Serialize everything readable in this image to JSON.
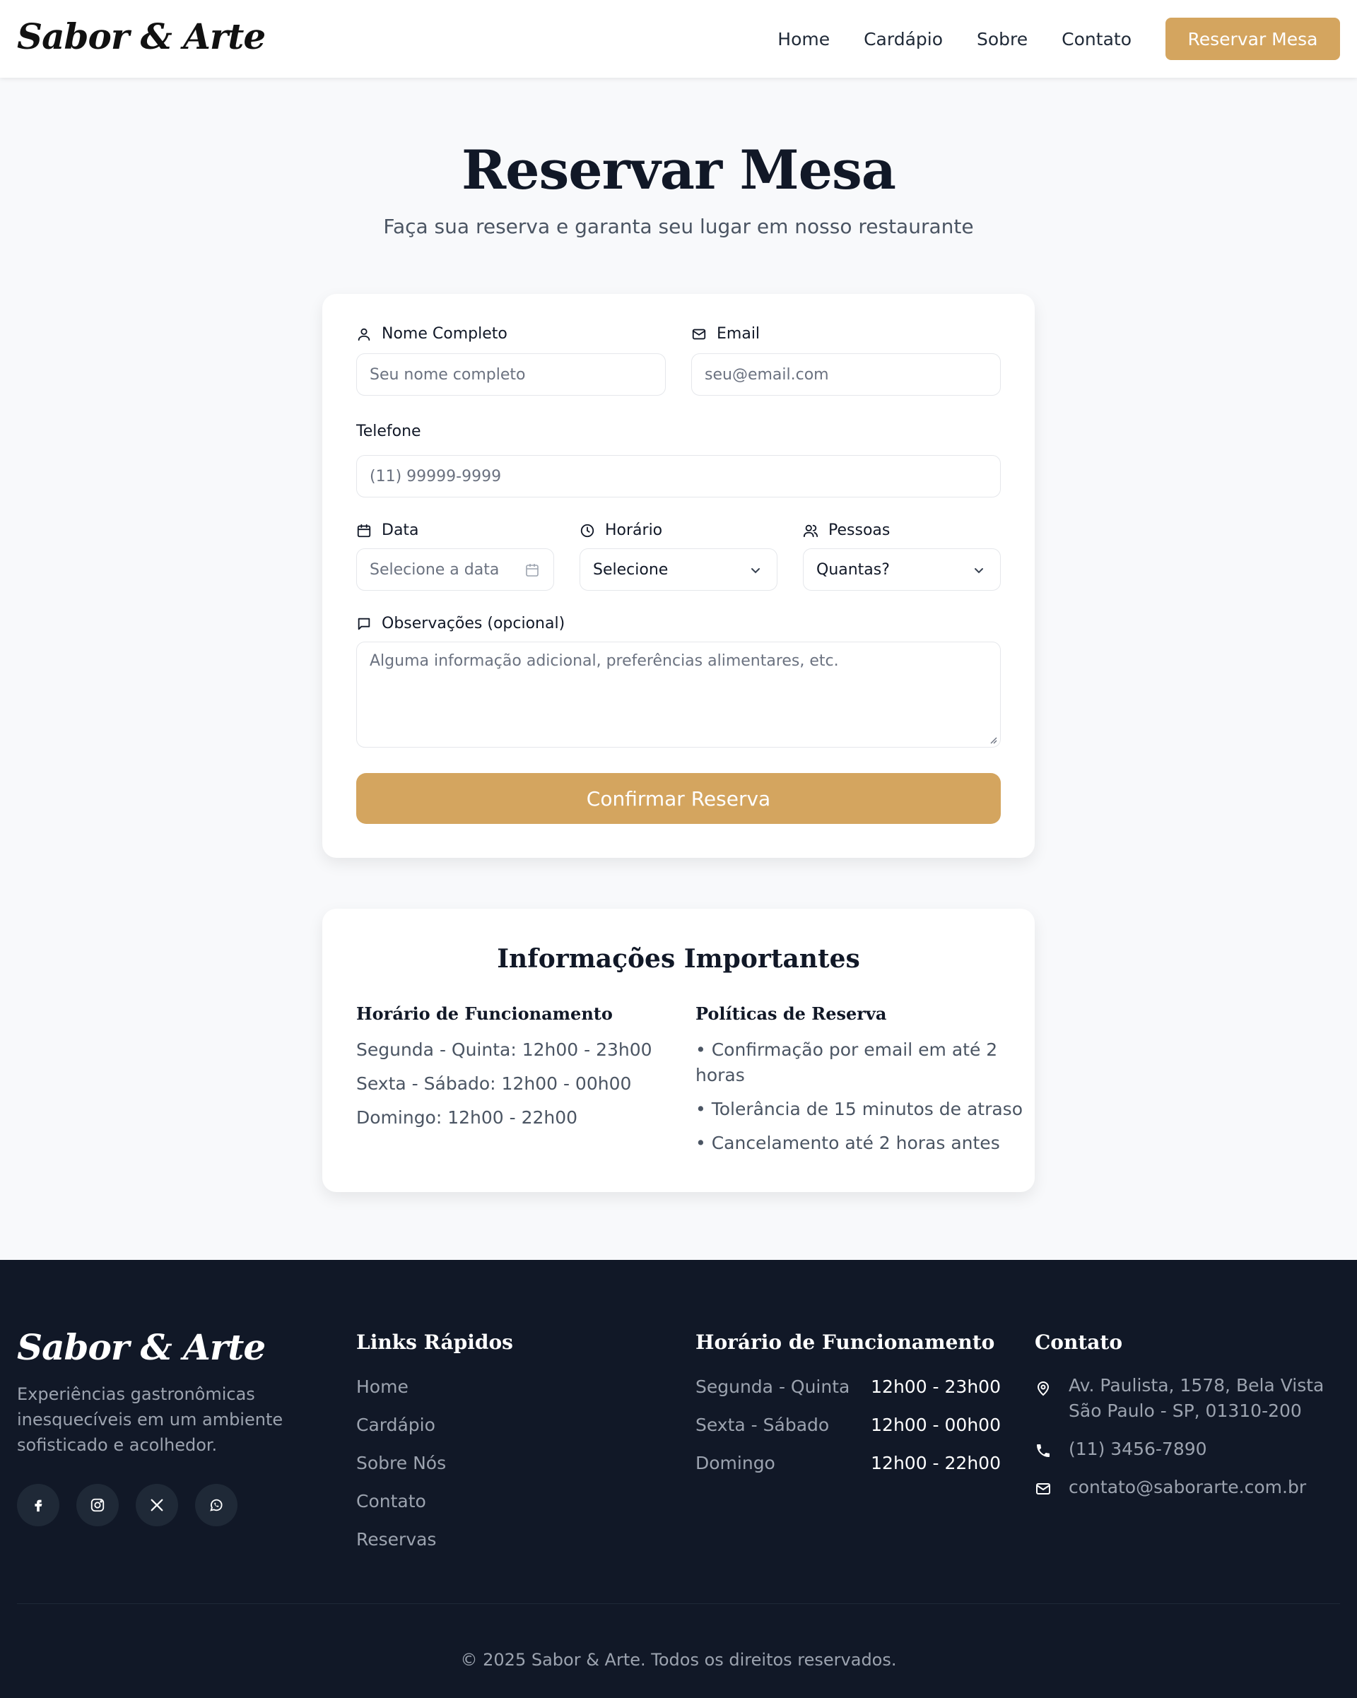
{
  "header": {
    "logo": "Sabor & Arte",
    "nav": [
      "Home",
      "Cardápio",
      "Sobre",
      "Contato"
    ],
    "cta": "Reservar Mesa"
  },
  "hero": {
    "title": "Reservar Mesa",
    "subtitle": "Faça sua reserva e garanta seu lugar em nosso restaurante"
  },
  "form": {
    "name_label": "Nome Completo",
    "name_placeholder": "Seu nome completo",
    "email_label": "Email",
    "email_placeholder": "seu@email.com",
    "phone_label": "Telefone",
    "phone_placeholder": "(11) 99999-9999",
    "date_label": "Data",
    "date_placeholder": "Selecione a data",
    "time_label": "Horário",
    "time_value": "Selecione",
    "people_label": "Pessoas",
    "people_value": "Quantas?",
    "notes_label": "Observações (opcional)",
    "notes_placeholder": "Alguma informação adicional, preferências alimentares, etc.",
    "submit": "Confirmar Reserva"
  },
  "info": {
    "title": "Informações Importantes",
    "hours_title": "Horário de Funcionamento",
    "hours": [
      "Segunda - Quinta: 12h00 - 23h00",
      "Sexta - Sábado: 12h00 - 00h00",
      "Domingo: 12h00 - 22h00"
    ],
    "policies_title": "Políticas de Reserva",
    "policies": [
      "• Confirmação por email em até 2",
      "horas",
      "• Tolerância de 15 minutos de atraso",
      "• Cancelamento até 2 horas antes"
    ]
  },
  "footer": {
    "logo": "Sabor & Arte",
    "description": "Experiências gastronômicas inesquecíveis em um ambiente sofisticado e acolhedor.",
    "links_title": "Links Rápidos",
    "links": [
      "Home",
      "Cardápio",
      "Sobre Nós",
      "Contato",
      "Reservas"
    ],
    "hours_title": "Horário de Funcionamento",
    "hours": [
      {
        "day": "Segunda - Quinta",
        "time": "12h00 - 23h00"
      },
      {
        "day": "Sexta - Sábado",
        "time": "12h00 - 00h00"
      },
      {
        "day": "Domingo",
        "time": "12h00 - 22h00"
      }
    ],
    "contact_title": "Contato",
    "address_line1": "Av. Paulista, 1578, Bela Vista",
    "address_line2": "São Paulo - SP, 01310-200",
    "phone": "(11) 3456-7890",
    "email": "contato@saborarte.com.br",
    "copyright": "© 2025 Sabor & Arte. Todos os direitos reservados."
  },
  "colors": {
    "accent": "#d4a55f",
    "dark": "#111827",
    "background": "#f8f9fb"
  },
  "icons": [
    "user-icon",
    "mail-icon",
    "calendar-icon",
    "clock-icon",
    "users-icon",
    "message-icon",
    "chevron-down-icon",
    "facebook-icon",
    "instagram-icon",
    "x-icon",
    "whatsapp-icon",
    "map-pin-icon",
    "phone-icon"
  ]
}
